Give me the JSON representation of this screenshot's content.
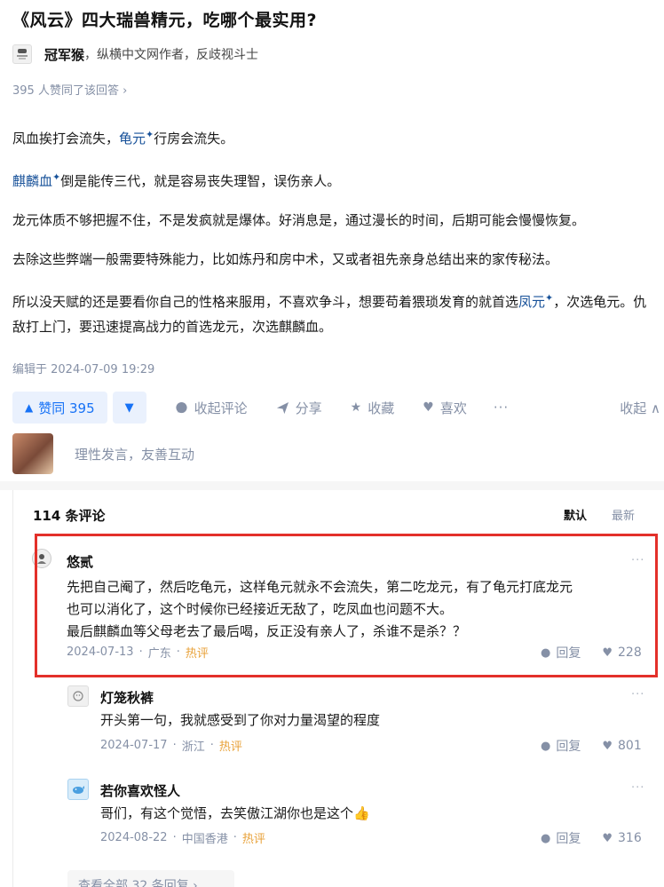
{
  "question": {
    "title": "《风云》四大瑞兽精元，吃哪个最实用?"
  },
  "author": {
    "avatar_icon": "author-avatar",
    "name": "冠军猴",
    "bio": "，纵横中文网作者，反歧视斗士"
  },
  "upvote_note": "395 人赞同了该回答 ›",
  "answer": {
    "p1_a": "凤血挨打会流失，",
    "p1_link": "龟元",
    "p1_b": "行房会流失。",
    "p2_link": "麒麟血",
    "p2_b": "倒是能传三代，就是容易丧失理智，误伤亲人。",
    "p3": "龙元体质不够把握不住，不是发疯就是爆体。好消息是，通过漫长的时间，后期可能会慢慢恢复。",
    "p4": "去除这些弊端一般需要特殊能力，比如炼丹和房中术，又或者祖先亲身总结出来的家传秘法。",
    "p5_a": "所以没天赋的还是要看你自己的性格来服用，不喜欢争斗，想要苟着猥琐发育的就首选",
    "p5_link": "凤元",
    "p5_b": "，次选龟元。仇敌打上门，要迅速提高战力的首选龙元，次选麒麟血。",
    "spark": "✦",
    "edited": "编辑于 2024-07-09 19:29"
  },
  "actions": {
    "upvote": "赞同 395",
    "upvote_icon": "▲",
    "downvote_icon": "▼",
    "collapse_comments": "收起评论",
    "share": "分享",
    "favorite": "收藏",
    "like": "喜欢",
    "more": "···",
    "collapse": "收起 ∧"
  },
  "reply": {
    "placeholder": "理性发言，友善互动"
  },
  "comments": {
    "count_label": "114 条评论",
    "sort_default": "默认",
    "sort_latest": "最新",
    "items": [
      {
        "name": "悠贰",
        "line1": "先把自己阉了，然后吃龟元，这样龟元就永不会流失，第二吃龙元，有了龟元打底龙元",
        "line2": "也可以消化了，这个时候你已经接近无敌了，吃凤血也问题不大。",
        "line3": "最后麒麟血等父母老去了最后喝，反正没有亲人了，杀谁不是杀？？",
        "date": "2024-07-13",
        "region": "广东",
        "tag": "热评",
        "reply_label": "回复",
        "likes": "228",
        "more": "···"
      },
      {
        "name": "灯笼秋裤",
        "line1": "开头第一句，我就感受到了你对力量渴望的程度",
        "date": "2024-07-17",
        "region": "浙江",
        "tag": "热评",
        "reply_label": "回复",
        "likes": "801",
        "more": "···"
      },
      {
        "name": "若你喜欢怪人",
        "line1": "哥们，有这个觉悟，去笑傲江湖你也是这个👍",
        "date": "2024-08-22",
        "region": "中国香港",
        "tag": "热评",
        "reply_label": "回复",
        "likes": "316",
        "more": "···"
      }
    ],
    "view_all": "查看全部 32 条回复 ›"
  },
  "colors": {
    "accent_blue": "#1772f6",
    "link_blue": "#175199",
    "highlight_red": "#e3302a",
    "hot_orange": "#e8a23a",
    "meta_gray": "#8590a6"
  }
}
